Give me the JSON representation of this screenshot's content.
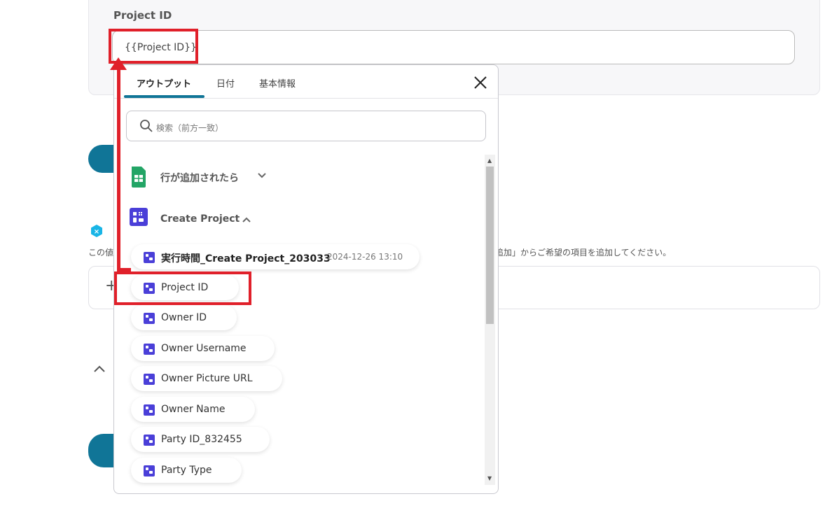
{
  "form": {
    "field_label": "Project ID",
    "field_value": "{{Project ID}}",
    "help_text_left": "この値",
    "help_text_right": "追加」からご希望の項目を追加してください。",
    "second_card_icon": "+",
    "collapse_toggle": "^"
  },
  "popup": {
    "tabs": [
      {
        "label": "アウトプット",
        "active": true
      },
      {
        "label": "日付",
        "active": false
      },
      {
        "label": "基本情報",
        "active": false
      }
    ],
    "close_icon": "close-icon",
    "search_placeholder": "検索（前方一致）",
    "groups": [
      {
        "label": "行が追加されたら",
        "icon": "google-sheets-icon",
        "expanded": false
      },
      {
        "label": "Create Project",
        "icon": "app-icon",
        "expanded": true
      }
    ],
    "items": [
      {
        "label": "実行時間_Create Project_203033",
        "sub": "2024-12-26 13:10"
      },
      {
        "label": "Project ID"
      },
      {
        "label": "Owner ID"
      },
      {
        "label": "Owner Username"
      },
      {
        "label": "Owner Picture URL"
      },
      {
        "label": "Owner Name"
      },
      {
        "label": "Party ID_832455"
      },
      {
        "label": "Party Type"
      }
    ]
  },
  "colors": {
    "accent": "#107597",
    "annotation": "#e0202a",
    "item_icon": "#4a3fd8",
    "sheets_green": "#23a566"
  }
}
